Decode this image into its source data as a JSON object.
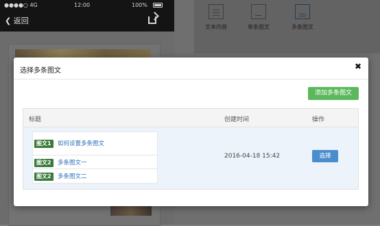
{
  "phone": {
    "status_bar": {
      "carrier": "●●●●○ 4G",
      "time": "12:00",
      "battery": "100%"
    },
    "nav": {
      "back_label": "返回",
      "back_icon": "chevron-left-icon",
      "share_icon": "share-icon"
    }
  },
  "type_selector": {
    "items": [
      {
        "label": "文本内容",
        "icon": "text-icon"
      },
      {
        "label": "单条图文",
        "icon": "single-article-icon"
      },
      {
        "label": "多条图文",
        "icon": "multi-article-icon",
        "active": true
      }
    ]
  },
  "modal": {
    "title": "选择多条图文",
    "close_label": "✖",
    "add_button_label": "添加多条图文",
    "table": {
      "headers": [
        "标题",
        "创建时间",
        "操作"
      ],
      "rows": [
        {
          "articles": [
            {
              "tag": "图文1",
              "title": "如何设置多条图文"
            },
            {
              "tag": "图文2",
              "title": "多条图文一"
            },
            {
              "tag": "图文2",
              "title": "多条图文二"
            }
          ],
          "created_time": "2016-04-18 15:42",
          "action_label": "选择"
        }
      ]
    }
  },
  "colors": {
    "accent_green": "#5cb85c",
    "accent_blue": "#4a8dcc",
    "tag_green": "#3a7a3a",
    "link_blue": "#2a6fb8"
  }
}
